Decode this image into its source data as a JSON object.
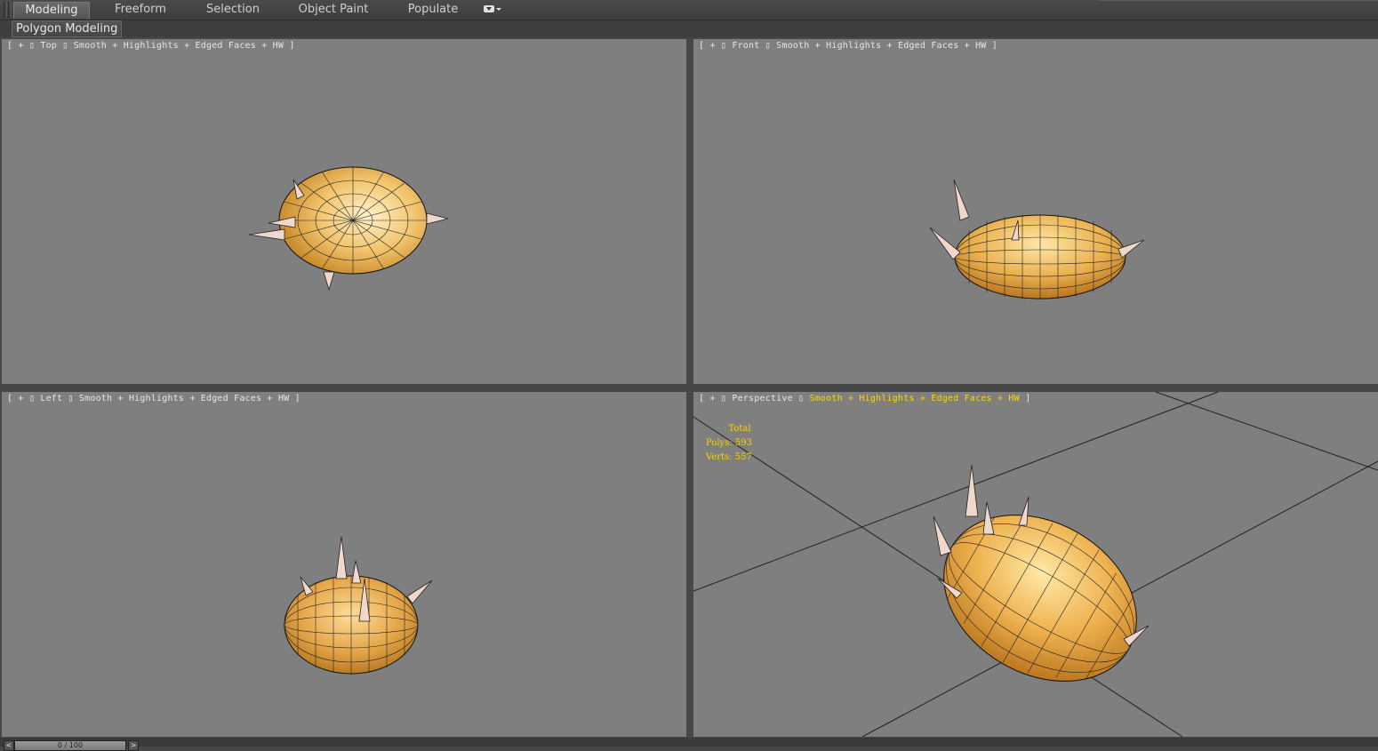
{
  "ribbon": {
    "tabs": [
      {
        "label": "Modeling",
        "active": true
      },
      {
        "label": "Freeform",
        "active": false
      },
      {
        "label": "Selection",
        "active": false
      },
      {
        "label": "Object Paint",
        "active": false
      },
      {
        "label": "Populate",
        "active": false
      }
    ],
    "dropdown_icon": "ribbon-options-icon"
  },
  "subbar": {
    "panel_label": "Polygon Modeling"
  },
  "viewports": {
    "top": {
      "plus": "+",
      "view": "Top",
      "shading": "Smooth + Highlights + Edged Faces + HW"
    },
    "front": {
      "plus": "+",
      "view": "Front",
      "shading": "Smooth + Highlights + Edged Faces + HW"
    },
    "left": {
      "plus": "+",
      "view": "Left",
      "shading": "Smooth + Highlights + Edged Faces + HW"
    },
    "perspective": {
      "plus": "+",
      "view": "Perspective",
      "shading": "Smooth + Highlights + Edged Faces + HW",
      "stats": {
        "total_label": "Total",
        "polys_label": "Polys:",
        "polys": "593",
        "verts_label": "Verts:",
        "verts": "557"
      }
    }
  },
  "timeline": {
    "position": "0 / 100",
    "prev": "<",
    "next": ">"
  },
  "colors": {
    "viewport_bg": "#7f7f7f",
    "ui_bg": "#474747",
    "highlight": "#ffd200",
    "potato": "#e8a850"
  }
}
